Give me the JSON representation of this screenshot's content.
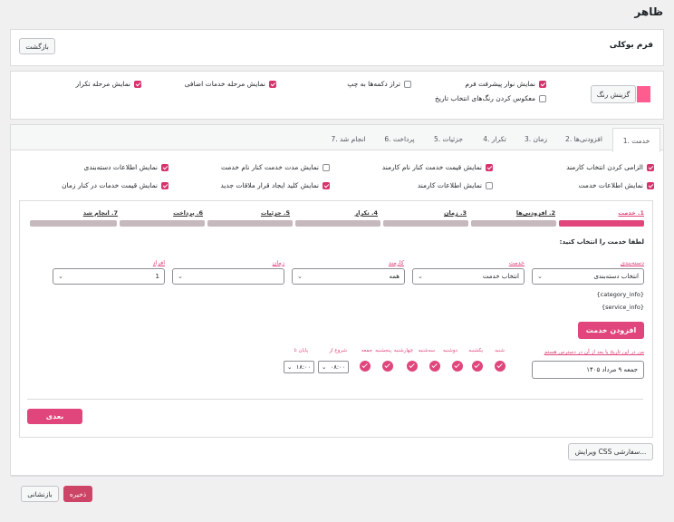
{
  "page": {
    "title": "ظاهر"
  },
  "header": {
    "form_name": "فرم بوکلی",
    "back_label": "بازگشت"
  },
  "colors": {
    "accent": "#e0457b",
    "checkbox": "#d6336c",
    "swatch": "#ff5d8f",
    "save": "#cc4466"
  },
  "settings": {
    "color_picker_label": "گزینش رنگ",
    "options": [
      {
        "label": "نمایش نوار پیشرفت فرم",
        "checked": true
      },
      {
        "label": "تراز دکمه‌ها به چپ",
        "checked": false
      },
      {
        "label": "نمایش مرحله خدمات اضافی",
        "checked": true
      },
      {
        "label": "نمایش مرحله تکرار",
        "checked": true
      },
      {
        "label": "معکوس کردن رنگ‌های انتخاب تاریخ",
        "checked": false
      }
    ]
  },
  "tabs": [
    "1. خدمت",
    "2. افزودنی‌ها",
    "3. زمان",
    "4. تکرار",
    "5. جزئیات",
    "6. پرداخت",
    "7. انجام شد"
  ],
  "service_options": [
    {
      "label": "الزامی کردن انتخاب کارمند",
      "checked": true
    },
    {
      "label": "نمایش قیمت خدمت کنار نام کارمند",
      "checked": true
    },
    {
      "label": "نمایش مدت خدمت کنار نام خدمت",
      "checked": false
    },
    {
      "label": "نمایش اطلاعات دسته‌بندی",
      "checked": true
    },
    {
      "label": "نمایش اطلاعات خدمت",
      "checked": true
    },
    {
      "label": "نمایش اطلاعات کارمند",
      "checked": false
    },
    {
      "label": "نمایش کلید ایجاد قرار ملاقات جدید",
      "checked": true
    },
    {
      "label": "نمایش قیمت خدمات در کنار زمان",
      "checked": true
    }
  ],
  "progress_steps": [
    "1. خدمت",
    "2. افزودنی‌ها",
    "3. زمان",
    "4. تکرار",
    "5. جزئیات",
    "6. پرداخت",
    "7. انجام شد"
  ],
  "form": {
    "instruction": "لطفا خدمت را انتخاب کنید:",
    "category_label": "دسته‌بندی",
    "category_value": "انتخاب دسته‌بندی",
    "service_label": "خدمت",
    "service_value": "انتخاب خدمت",
    "employee_label": "کارمند",
    "employee_value": "همه",
    "time_label": "زمان",
    "time_value": "",
    "persons_label": "افراد",
    "persons_value": "1",
    "category_info": "{category_info}",
    "service_info": "{service_info}",
    "add_service_label": "افزودن خدمت",
    "date_label": "من در این تاریخ یا بعد از آن در دسترس هستم",
    "date_value": "جمعه ۹ مرداد ۱۴۰۵",
    "days": [
      "شنبه",
      "یکشنبه",
      "دوشنبه",
      "سه‌شنبه",
      "چهارشنبه",
      "پنجشنبه",
      "جمعه"
    ],
    "start_label": "شروع از",
    "start_value": "۰۸:۰۰",
    "end_label": "پایان تا",
    "end_value": "۱۸:۰۰",
    "next_label": "بعدی"
  },
  "footer": {
    "custom_css_label": "ویرایش CSS سفارشی...",
    "save_label": "ذخیره",
    "reset_label": "بازنشانی"
  }
}
